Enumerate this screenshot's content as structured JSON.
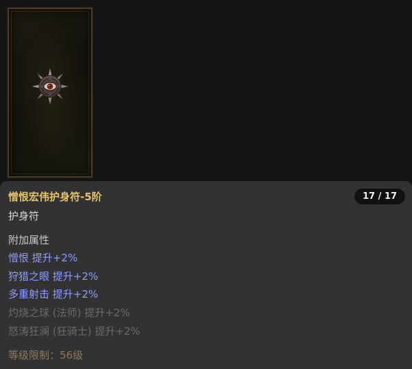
{
  "item": {
    "icon": "amulet-eye-icon",
    "name": "憎恨宏伟护身符-5阶",
    "count": "17 / 17",
    "type": "护身符",
    "affix_header": "附加属性",
    "affixes": [
      {
        "text": "憎恨 提升+2%",
        "active": true
      },
      {
        "text": "狩猎之眼 提升+2%",
        "active": true
      },
      {
        "text": "多重射击 提升+2%",
        "active": true
      },
      {
        "text": "灼烧之球 (法师) 提升+2%",
        "active": false
      },
      {
        "text": "怒涛狂澜 (狂骑士) 提升+2%",
        "active": false
      }
    ],
    "level_requirement": "等级限制：56级"
  },
  "colors": {
    "title": "#e6c365",
    "active_affix": "#8f9cff",
    "inactive_affix": "#6a6a6a",
    "level_requirement": "#8e7a5a",
    "panel_bg": "#323232",
    "badge_bg": "#111111"
  }
}
